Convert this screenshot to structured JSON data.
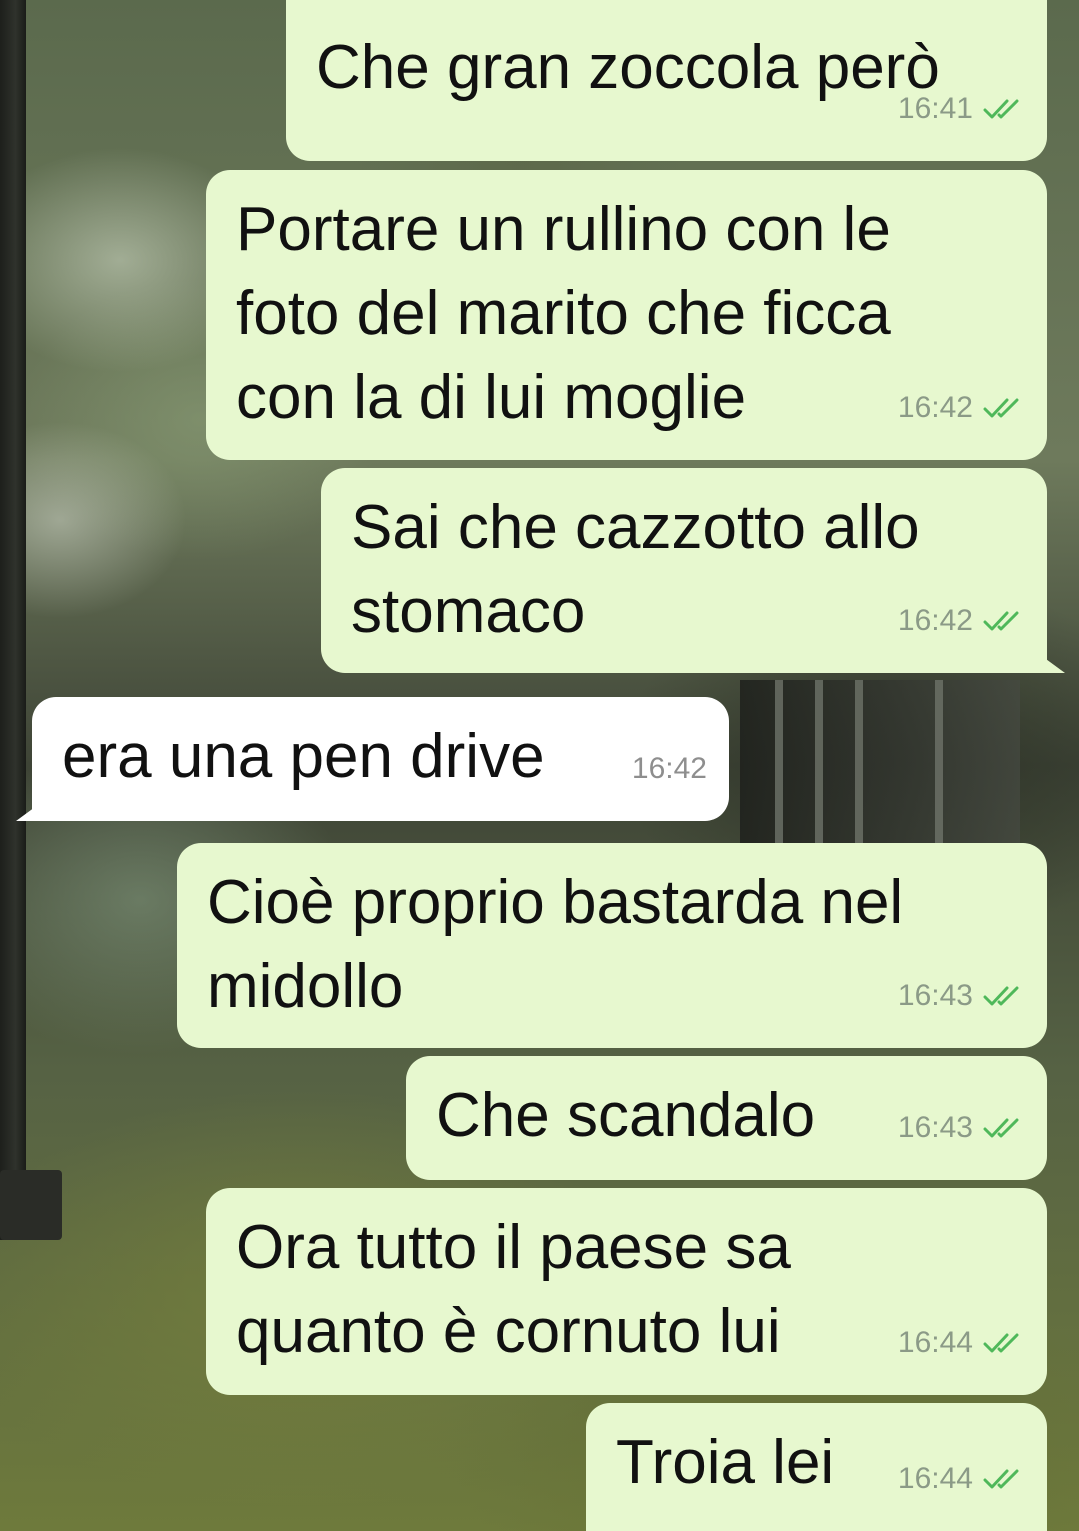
{
  "messages": [
    {
      "text": "Che gran zoccola però",
      "time": "16:41",
      "direction": "outgoing",
      "status": "read"
    },
    {
      "text": "Portare un rullino con le\nfoto del marito che ficca\ncon la di lui moglie",
      "time": "16:42",
      "direction": "outgoing",
      "status": "read"
    },
    {
      "text": "Sai che cazzotto allo\nstomaco",
      "time": "16:42",
      "direction": "outgoing",
      "status": "read"
    },
    {
      "text": "era una pen drive",
      "time": "16:42",
      "direction": "incoming"
    },
    {
      "text": "Cioè proprio bastarda nel\nmidollo",
      "time": "16:43",
      "direction": "outgoing",
      "status": "read"
    },
    {
      "text": "Che scandalo",
      "time": "16:43",
      "direction": "outgoing",
      "status": "read"
    },
    {
      "text": "Ora tutto il paese sa\nquanto è cornuto lui",
      "time": "16:44",
      "direction": "outgoing",
      "status": "read"
    },
    {
      "text": "Troia lei",
      "time": "16:44",
      "direction": "outgoing",
      "status": "read"
    }
  ],
  "colors": {
    "outgoing_bubble": "#e7f8cf",
    "incoming_bubble": "#ffffff",
    "read_ticks": "#4fb85a"
  }
}
